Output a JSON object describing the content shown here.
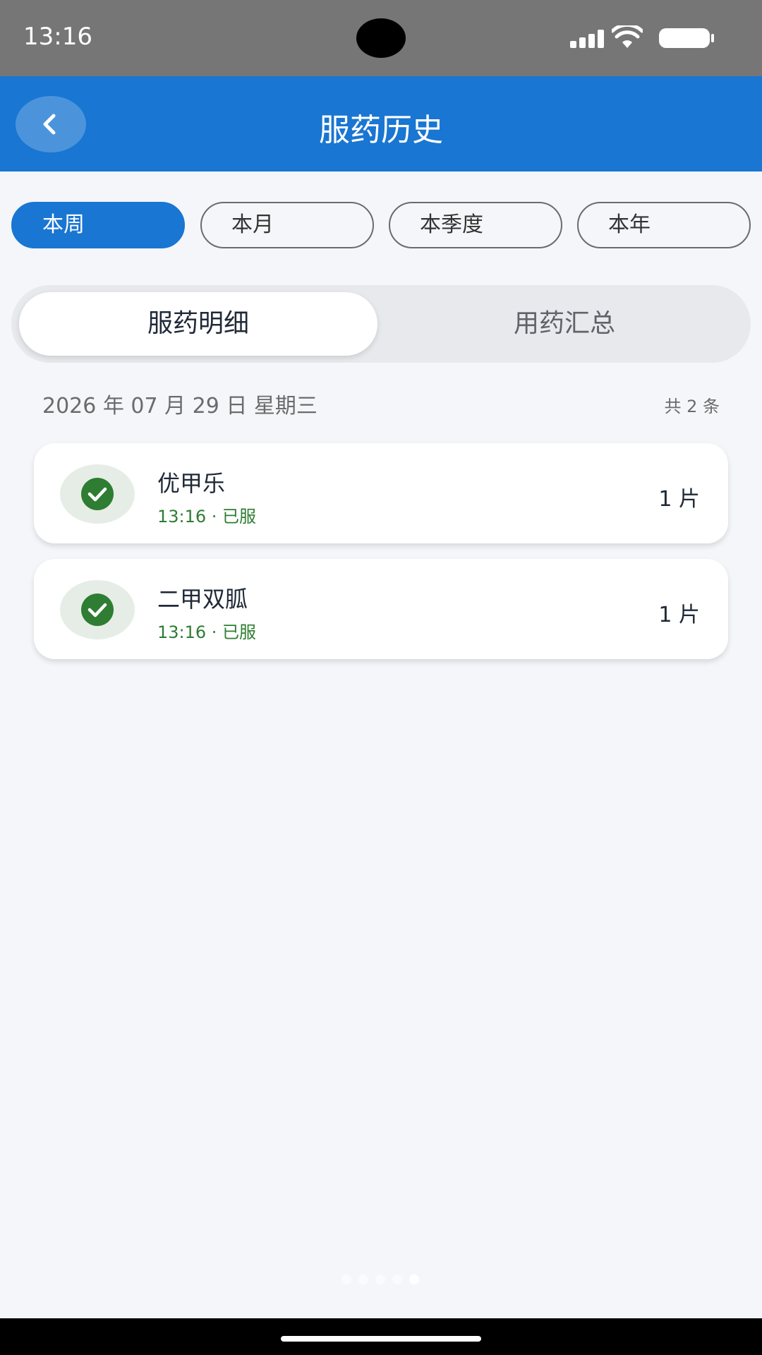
{
  "status_bar": {
    "time": "13:16"
  },
  "header": {
    "title": "服药历史"
  },
  "filters": [
    {
      "label": "本周",
      "active": true
    },
    {
      "label": "本月",
      "active": false
    },
    {
      "label": "本季度",
      "active": false
    },
    {
      "label": "本年",
      "active": false
    }
  ],
  "segments": [
    {
      "label": "服药明细",
      "active": true
    },
    {
      "label": "用药汇总",
      "active": false
    }
  ],
  "date_group": {
    "date": "2026 年 07 月 29 日 星期三",
    "count": "共 2 条"
  },
  "records": [
    {
      "name": "优甲乐",
      "status": "13:16 · 已服",
      "dose": "1 片"
    },
    {
      "name": "二甲双胍",
      "status": "13:16 · 已服",
      "dose": "1 片"
    }
  ],
  "colors": {
    "primary": "#1976d2",
    "taken": "#2e7d32",
    "background": "#f4f6fa"
  },
  "page_indicator": {
    "total": 5,
    "current": 5
  }
}
